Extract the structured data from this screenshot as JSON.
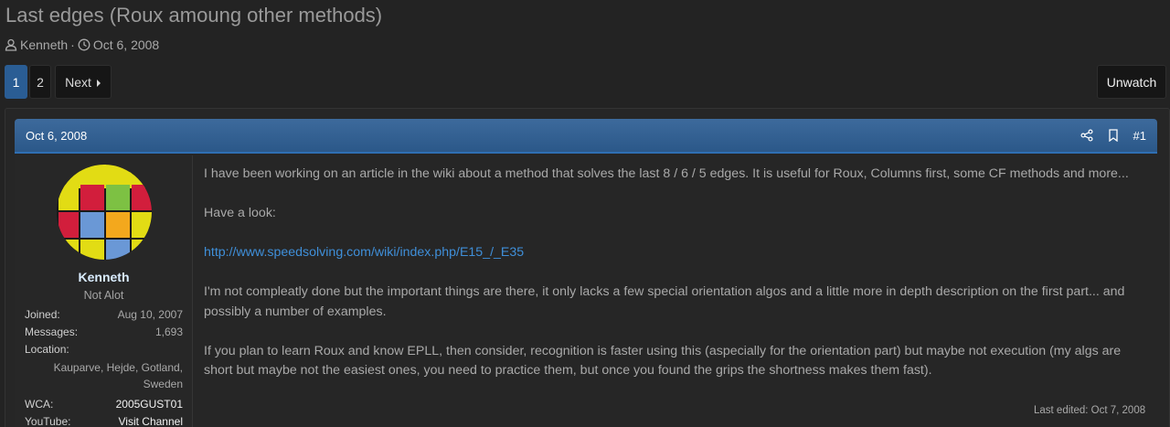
{
  "thread": {
    "title": "Last edges (Roux amoung other methods)",
    "author": "Kenneth",
    "date": "Oct 6, 2008",
    "separator": "·"
  },
  "pagination": {
    "pages": [
      "1",
      "2"
    ],
    "current_page": "1",
    "next_label": "Next"
  },
  "watch": {
    "label": "Unwatch"
  },
  "post": {
    "date": "Oct 6, 2008",
    "number": "#1",
    "icons": {
      "share": "share-icon",
      "bookmark": "bookmark-icon"
    },
    "user": {
      "name": "Kenneth",
      "title": "Not Alot",
      "fields": {
        "joined_label": "Joined:",
        "joined_value": "Aug 10, 2007",
        "messages_label": "Messages:",
        "messages_value": "1,693",
        "location_label": "Location:",
        "location_value": "Kauparve, Hejde, Gotland, Sweden",
        "wca_label": "WCA:",
        "wca_value": "2005GUST01",
        "youtube_label": "YouTube:",
        "youtube_value": "Visit Channel"
      }
    },
    "body": {
      "p1": "I have been working on an article in the wiki about a method that solves the last 8 / 6 / 5 edges. It is useful for Roux, Columns first, some CF methods and more...",
      "p2": "Have a look:",
      "link": "http://www.speedsolving.com/wiki/index.php/E15_/_E35",
      "p3": "I'm not compleatly done but the important things are there, it only lacks a few special orientation algos and a little more in depth description on the first part... and possibly a number of examples.",
      "p4": "If you plan to learn Roux and know EPLL, then consider, recognition is faster using this (aspecially for the orientation part) but maybe not execution (my algs are short but maybe not the easiest ones, you need to practice them, but once you found the grips the shortness makes them fast)."
    },
    "last_edited": "Last edited: Oct 7, 2008"
  },
  "colors": {
    "background": "#232323",
    "accent_blue": "#2a5d94",
    "header_blue": "#3d6a9c",
    "link": "#3f8fd9",
    "username": "#d9ecff"
  }
}
